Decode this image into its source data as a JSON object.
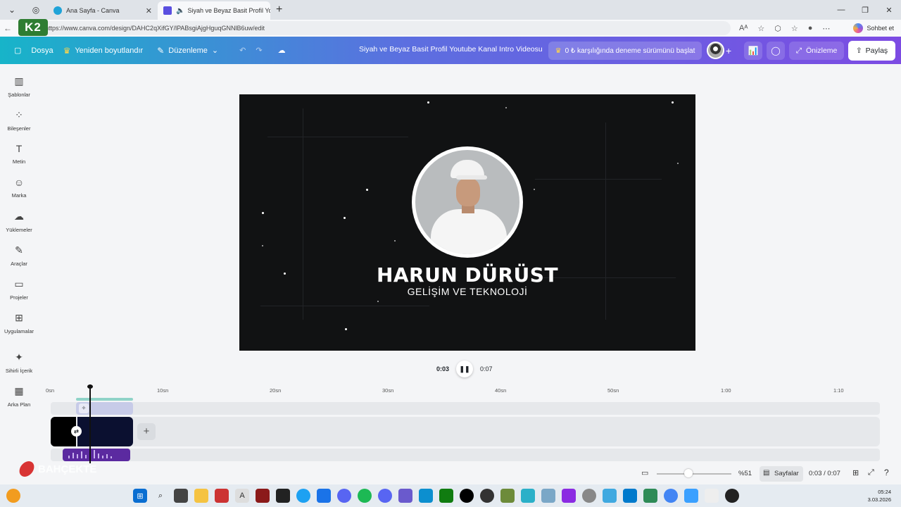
{
  "browser": {
    "tabs": [
      {
        "title": "Ana Sayfa - Canva"
      },
      {
        "title": "Siyah ve Beyaz Basit Profil Yout"
      }
    ],
    "url": "https://www.canva.com/design/DAHC2qXifGY/lPABsgiAjgHguqGNNlB6uw/edit",
    "chat_label": "Sohbet et",
    "badge": "K2"
  },
  "toolbar": {
    "file": "Dosya",
    "resize": "Yeniden boyutlandır",
    "edit": "Düzenleme",
    "title": "Siyah ve Beyaz Basit Profil Youtube Kanal Intro Videosu",
    "trial": "0 ₺ karşılığında deneme sürümünü başlat",
    "preview": "Önizleme",
    "share": "Paylaş"
  },
  "sidebar": {
    "items": [
      {
        "label": "Şablonlar",
        "icon": "template-icon"
      },
      {
        "label": "Bileşenler",
        "icon": "elements-icon"
      },
      {
        "label": "Metin",
        "icon": "text-icon"
      },
      {
        "label": "Marka",
        "icon": "brand-icon"
      },
      {
        "label": "Yüklemeler",
        "icon": "upload-icon"
      },
      {
        "label": "Araçlar",
        "icon": "tools-icon"
      },
      {
        "label": "Projeler",
        "icon": "folder-icon"
      },
      {
        "label": "Uygulamalar",
        "icon": "apps-icon"
      },
      {
        "label": "Sihirli İçerik",
        "icon": "magic-icon"
      },
      {
        "label": "Arka Plan",
        "icon": "background-icon"
      }
    ]
  },
  "design": {
    "name": "HARUN DÜRÜST",
    "subtitle": "GELİŞİM VE TEKNOLOJİ"
  },
  "player": {
    "current": "0:03",
    "total": "0:07"
  },
  "timeline": {
    "ticks": [
      "0sn",
      "10sn",
      "20sn",
      "30sn",
      "40sn",
      "50sn",
      "1:00",
      "1:10"
    ]
  },
  "footer": {
    "zoom": "%51",
    "pages": "Sayfalar",
    "time": "0:03 / 0:07"
  },
  "taskbar": {
    "time": "05:24",
    "date": "3.03.2026"
  },
  "watermark": "BAHÇEKTE"
}
